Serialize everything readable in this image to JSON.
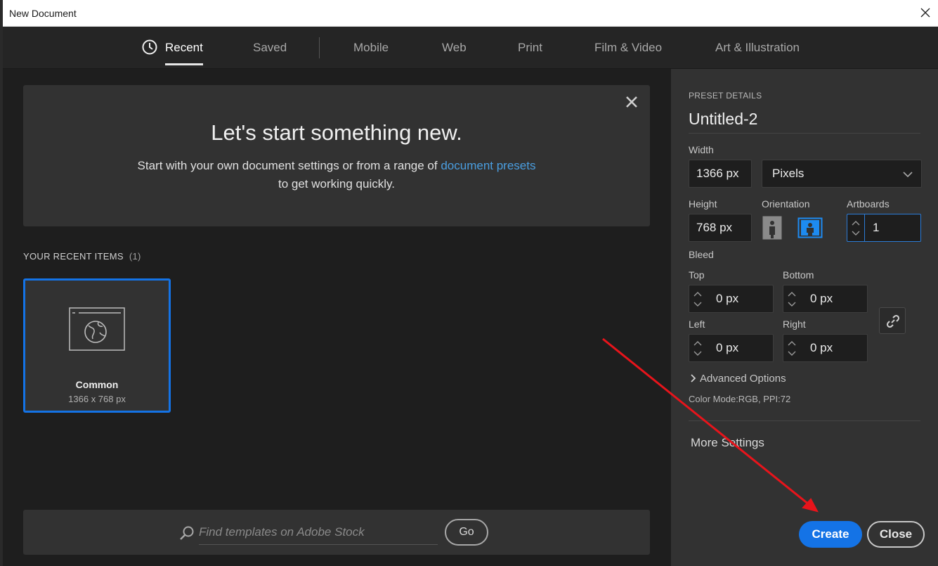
{
  "window": {
    "title": "New Document"
  },
  "tabs": [
    {
      "label": "Recent",
      "active": true
    },
    {
      "label": "Saved"
    },
    {
      "label": "Mobile"
    },
    {
      "label": "Web"
    },
    {
      "label": "Print"
    },
    {
      "label": "Film & Video"
    },
    {
      "label": "Art & Illustration"
    }
  ],
  "hero": {
    "heading": "Let's start something new.",
    "line1_prefix": "Start with your own document settings or from a range of ",
    "line1_link": "document presets",
    "line2": "to get working quickly."
  },
  "recent": {
    "label": "YOUR RECENT ITEMS",
    "count": "(1)",
    "items": [
      {
        "name": "Common",
        "size": "1366 x 768 px"
      }
    ]
  },
  "stock": {
    "placeholder": "Find templates on Adobe Stock",
    "go_label": "Go"
  },
  "preset": {
    "section_title": "PRESET DETAILS",
    "name": "Untitled-2",
    "width_label": "Width",
    "width_value": "1366 px",
    "units_value": "Pixels",
    "height_label": "Height",
    "height_value": "768 px",
    "orientation_label": "Orientation",
    "artboards_label": "Artboards",
    "artboards_value": "1",
    "bleed_label": "Bleed",
    "top_label": "Top",
    "top_value": "0 px",
    "bottom_label": "Bottom",
    "bottom_value": "0 px",
    "left_label": "Left",
    "left_value": "0 px",
    "right_label": "Right",
    "right_value": "0 px",
    "advanced_label": "Advanced Options",
    "color_mode": "Color Mode:RGB, PPI:72",
    "more_settings": "More Settings"
  },
  "actions": {
    "create_label": "Create",
    "close_label": "Close"
  },
  "colors": {
    "accent": "#1473e6",
    "annotation_arrow": "#e8141b",
    "link": "#4a9ee0"
  }
}
